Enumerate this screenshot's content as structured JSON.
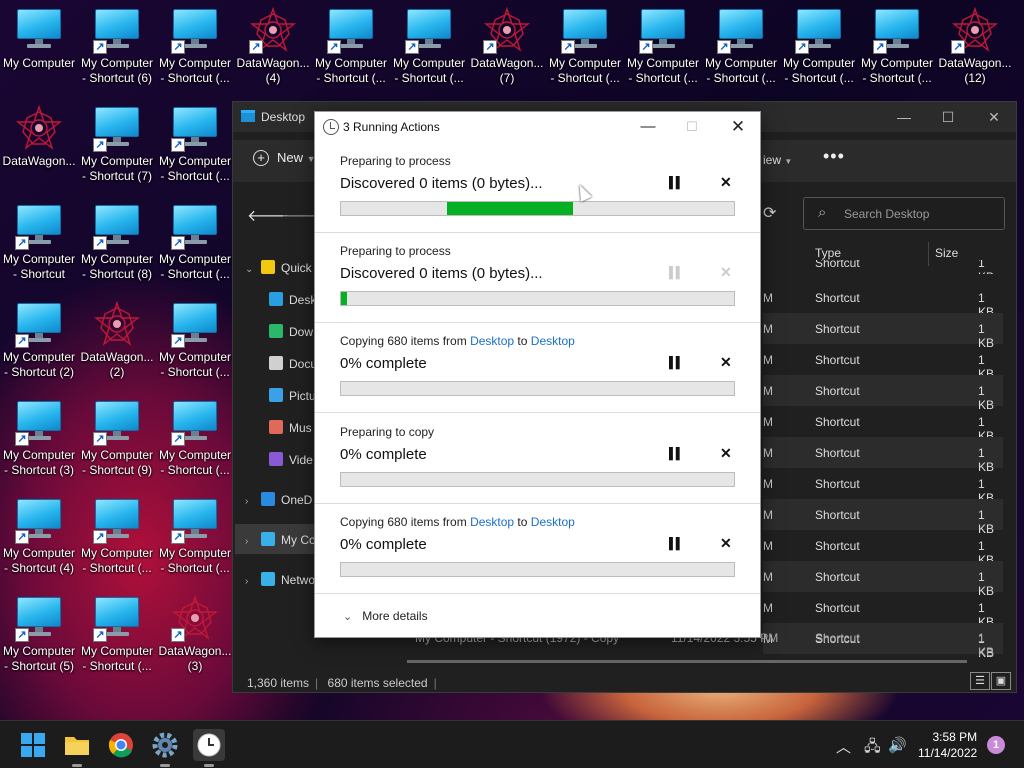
{
  "desktop_icons": [
    {
      "label": "My Computer",
      "type": "computer",
      "shortcut": false
    },
    {
      "label": "My Computer\n- Shortcut (6)",
      "type": "computer",
      "shortcut": true
    },
    {
      "label": "My Computer\n- Shortcut (...",
      "type": "computer",
      "shortcut": true
    },
    {
      "label": "DataWagon...\n(4)",
      "type": "datawagon",
      "shortcut": true
    },
    {
      "label": "My Computer\n- Shortcut (...",
      "type": "computer",
      "shortcut": true
    },
    {
      "label": "My Computer\n- Shortcut (...",
      "type": "computer",
      "shortcut": true
    },
    {
      "label": "DataWagon...\n(7)",
      "type": "datawagon",
      "shortcut": true
    },
    {
      "label": "My Computer\n- Shortcut (...",
      "type": "computer",
      "shortcut": true
    },
    {
      "label": "My Computer\n- Shortcut (...",
      "type": "computer",
      "shortcut": true
    },
    {
      "label": "My Computer\n- Shortcut (...",
      "type": "computer",
      "shortcut": true
    },
    {
      "label": "My Computer\n- Shortcut (...",
      "type": "computer",
      "shortcut": true
    },
    {
      "label": "My Computer\n- Shortcut (...",
      "type": "computer",
      "shortcut": true
    },
    {
      "label": "DataWagon...\n(12)",
      "type": "datawagon",
      "shortcut": true
    },
    {
      "label": "DataWagon...",
      "type": "datawagon",
      "shortcut": false
    },
    {
      "label": "My Computer\n- Shortcut (7)",
      "type": "computer",
      "shortcut": true
    },
    {
      "label": "My Computer\n- Shortcut (...",
      "type": "computer",
      "shortcut": true
    },
    {
      "label": "My Computer\n- Shortcut",
      "type": "computer",
      "shortcut": true
    },
    {
      "label": "My Computer\n- Shortcut (8)",
      "type": "computer",
      "shortcut": true
    },
    {
      "label": "My Computer\n- Shortcut (...",
      "type": "computer",
      "shortcut": true
    },
    {
      "label": "My Computer\n- Shortcut (2)",
      "type": "computer",
      "shortcut": true
    },
    {
      "label": "DataWagon...\n(2)",
      "type": "datawagon",
      "shortcut": false
    },
    {
      "label": "My Computer\n- Shortcut (...",
      "type": "computer",
      "shortcut": true
    },
    {
      "label": "My Computer\n- Shortcut (3)",
      "type": "computer",
      "shortcut": true
    },
    {
      "label": "My Computer\n- Shortcut (9)",
      "type": "computer",
      "shortcut": true
    },
    {
      "label": "My Computer\n- Shortcut (...",
      "type": "computer",
      "shortcut": true
    },
    {
      "label": "My Computer\n- Shortcut (4)",
      "type": "computer",
      "shortcut": true
    },
    {
      "label": "My Computer\n- Shortcut (...",
      "type": "computer",
      "shortcut": true
    },
    {
      "label": "My Computer\n- Shortcut (...",
      "type": "computer",
      "shortcut": true
    },
    {
      "label": "My Computer\n- Shortcut (5)",
      "type": "computer",
      "shortcut": true
    },
    {
      "label": "My Computer\n- Shortcut (...",
      "type": "computer",
      "shortcut": true
    },
    {
      "label": "DataWagon...\n(3)",
      "type": "datawagon",
      "shortcut": true
    }
  ],
  "explorer": {
    "title": "Desktop",
    "toolbar": {
      "new_label": "New",
      "view_label": "iew",
      "more_label": "•••"
    },
    "search_placeholder": "Search Desktop",
    "sidebar": [
      {
        "label": "Quick",
        "icon": "star-icon",
        "color": "#f2c811",
        "chev": "⌄"
      },
      {
        "label": "Desk",
        "icon": "desktop-icon",
        "color": "#2a9fe0",
        "chev": ""
      },
      {
        "label": "Dow",
        "icon": "download-icon",
        "color": "#2bb86a",
        "chev": ""
      },
      {
        "label": "Docu",
        "icon": "document-icon",
        "color": "#d0d0d0",
        "chev": ""
      },
      {
        "label": "Pictu",
        "icon": "pictures-icon",
        "color": "#3aa0e8",
        "chev": ""
      },
      {
        "label": "Mus",
        "icon": "music-icon",
        "color": "#e06a5a",
        "chev": ""
      },
      {
        "label": "Vide",
        "icon": "video-icon",
        "color": "#8a5ad6",
        "chev": ""
      },
      {
        "label": "OneD",
        "icon": "cloud-icon",
        "color": "#2a8ae0",
        "chev": "›"
      },
      {
        "label": "My Co",
        "icon": "computer-icon",
        "color": "#39b0e8",
        "chev": "›"
      },
      {
        "label": "Netwo",
        "icon": "network-icon",
        "color": "#39b0e8",
        "chev": "›"
      }
    ],
    "columns": {
      "type": "Type",
      "size": "Size"
    },
    "rows": [
      {
        "m": "M",
        "type": "Shortcut",
        "size": "1 KB"
      },
      {
        "m": "M",
        "type": "Shortcut",
        "size": "1 KB"
      },
      {
        "m": "M",
        "type": "Shortcut",
        "size": "1 KB"
      },
      {
        "m": "M",
        "type": "Shortcut",
        "size": "1 KB"
      },
      {
        "m": "M",
        "type": "Shortcut",
        "size": "1 KB"
      },
      {
        "m": "M",
        "type": "Shortcut",
        "size": "1 KB"
      },
      {
        "m": "M",
        "type": "Shortcut",
        "size": "1 KB"
      },
      {
        "m": "M",
        "type": "Shortcut",
        "size": "1 KB"
      },
      {
        "m": "M",
        "type": "Shortcut",
        "size": "1 KB"
      },
      {
        "m": "M",
        "type": "Shortcut",
        "size": "1 KB"
      },
      {
        "m": "M",
        "type": "Shortcut",
        "size": "1 KB"
      },
      {
        "m": "M",
        "type": "Shortcut",
        "size": "1 KB"
      }
    ],
    "partial_top_row": {
      "type": "Shortcut",
      "size": "1 KB"
    },
    "last_row": {
      "name": "My Computer - Shortcut (1972) - Copy",
      "date": "11/14/2022 3:55 PM",
      "type": "Shortcut",
      "size": "1 KB"
    },
    "status": {
      "items": "1,360 items",
      "selected": "680 items selected"
    }
  },
  "dialog": {
    "title": "3 Running Actions",
    "actions": [
      {
        "sub": "Preparing to process",
        "from": "",
        "to": "",
        "main": "Discovered 0 items (0 bytes)...",
        "progress_start": 0.27,
        "progress_end": 0.59,
        "enabled": true
      },
      {
        "sub": "Preparing to process",
        "from": "",
        "to": "",
        "main": "Discovered 0 items (0 bytes)...",
        "progress_start": 0,
        "progress_end": 0.015,
        "enabled": false
      },
      {
        "sub": "Copying 680 items from ",
        "from": "Desktop",
        "to": "Desktop",
        "main": "0% complete",
        "progress_start": 0,
        "progress_end": 0,
        "enabled": true
      },
      {
        "sub": "Preparing to copy",
        "from": "",
        "to": "",
        "main": "0% complete",
        "progress_start": 0,
        "progress_end": 0,
        "enabled": true
      },
      {
        "sub": "Copying 680 items from ",
        "from": "Desktop",
        "to": "Desktop",
        "main": "0% complete",
        "progress_start": 0,
        "progress_end": 0,
        "enabled": true
      }
    ],
    "to_word": " to ",
    "more_details": "More details"
  },
  "taskbar": {
    "time": "3:58 PM",
    "date": "11/14/2022",
    "notification_count": "1",
    "apps": [
      "windows-start-icon",
      "file-explorer-icon",
      "chrome-icon",
      "settings-icon",
      "clock-icon"
    ]
  },
  "colors": {
    "progress_green": "#06b025",
    "link_blue": "#1a6fc8",
    "monitor_blue": "#28b6ee",
    "datawagon_red": "#c01838"
  }
}
